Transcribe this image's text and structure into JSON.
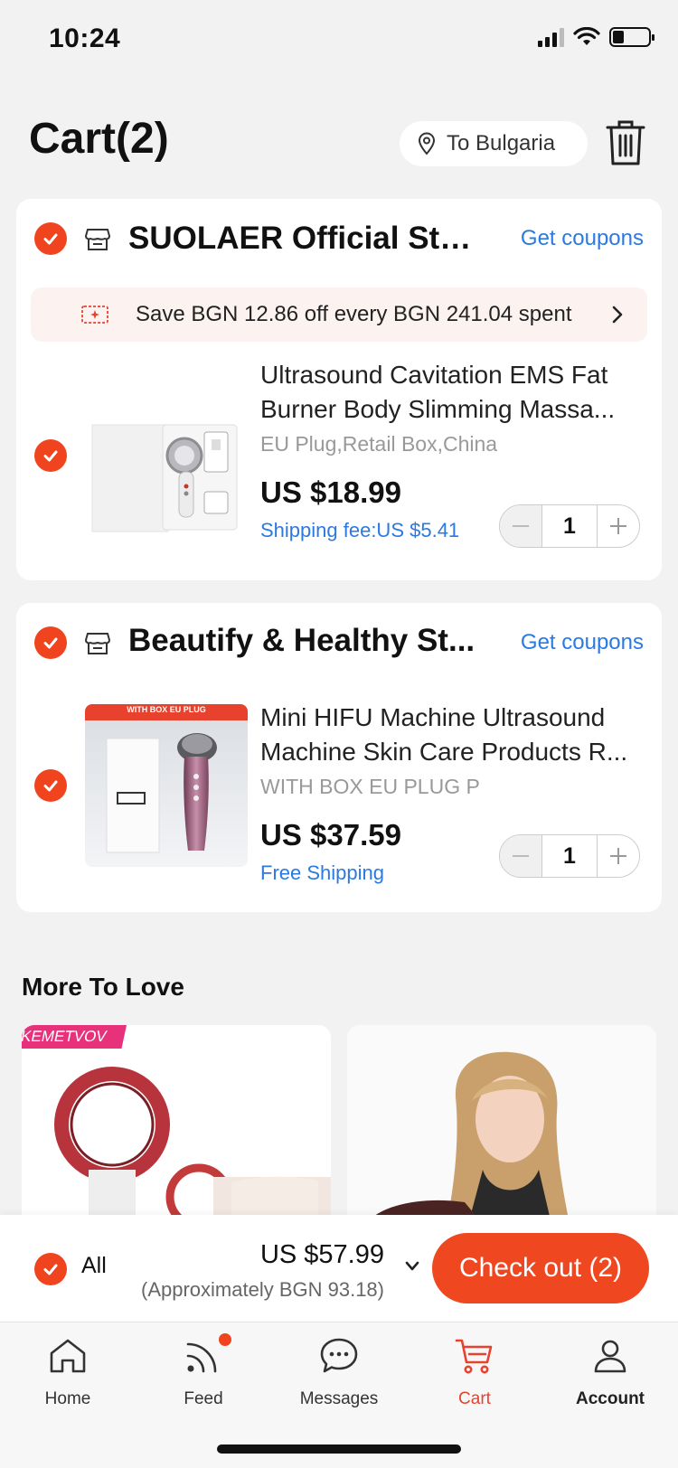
{
  "status_bar": {
    "time": "10:24"
  },
  "header": {
    "title": "Cart(2)",
    "location": "To Bulgaria"
  },
  "stores": [
    {
      "name": "SUOLAER Official Store",
      "coupons_label": "Get coupons",
      "promo": "Save BGN 12.86 off every BGN 241.04 spent",
      "item": {
        "title": "Ultrasound Cavitation EMS Fat Burner Body Slimming Massa...",
        "variant": "EU Plug,Retail Box,China",
        "price": "US $18.99",
        "shipping": "Shipping fee:US $5.41",
        "quantity": "1"
      }
    },
    {
      "name": "Beautify & Healthy St...",
      "coupons_label": "Get coupons",
      "item": {
        "title": "Mini HIFU Machine Ultrasound Machine Skin Care Products R...",
        "variant": "WITH BOX EU PLUG P",
        "price": "US $37.59",
        "shipping": "Free Shipping",
        "quantity": "1",
        "image_banner": "WITH BOX EU PLUG"
      }
    }
  ],
  "more_to_love": {
    "title": "More To Love",
    "items": [
      {
        "badge": "KEMETVOV"
      },
      {
        "badge": ""
      }
    ]
  },
  "checkout": {
    "all_label": "All",
    "total": "US $57.99",
    "approx": "(Approximately BGN 93.18)",
    "button": "Check out (2)"
  },
  "tabs": [
    {
      "label": "Home",
      "icon": "home-icon"
    },
    {
      "label": "Feed",
      "icon": "feed-icon"
    },
    {
      "label": "Messages",
      "icon": "messages-icon"
    },
    {
      "label": "Cart",
      "icon": "cart-icon"
    },
    {
      "label": "Account",
      "icon": "account-icon"
    }
  ],
  "colors": {
    "accent": "#f0441f",
    "link": "#2a7ae2",
    "checkout": "#ef4820"
  }
}
